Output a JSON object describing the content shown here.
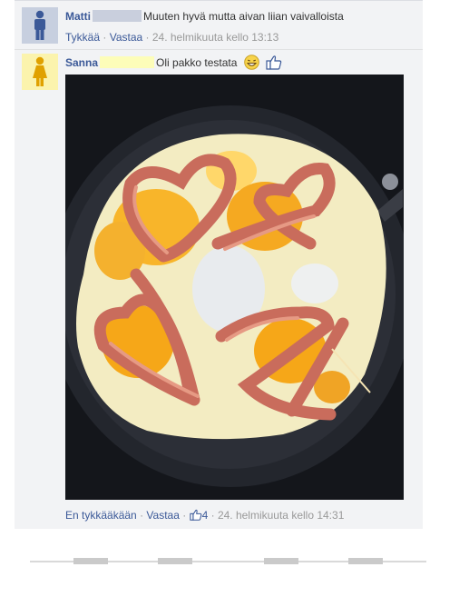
{
  "comments": [
    {
      "author": "Matti",
      "text": "Muuten hyvä mutta aivan liian vaivalloista",
      "like_label": "Tykkää",
      "reply_label": "Vastaa",
      "timestamp": "24. helmikuuta kello 13:13",
      "avatar_icon": "male-silhouette-icon"
    },
    {
      "author": "Sanna",
      "text": "Oli pakko testata",
      "emoticons": [
        "grin-emoticon",
        "thumbs-up-emoticon"
      ],
      "unlike_label": "En tykkääkään",
      "reply_label": "Vastaa",
      "like_count": "4",
      "timestamp": "24. helmikuuta kello 14:31",
      "avatar_icon": "female-silhouette-icon"
    }
  ],
  "separator": "·",
  "colors": {
    "link": "#3b5998",
    "meta": "#999999",
    "thread_bg": "#f2f3f5"
  }
}
